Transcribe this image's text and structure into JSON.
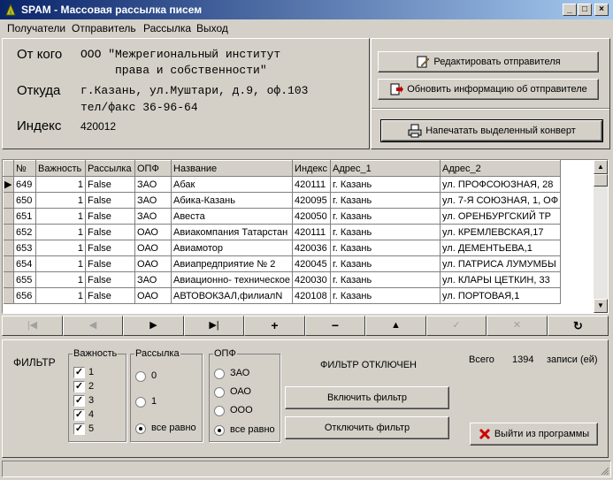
{
  "window": {
    "title": "SPAM - Массовая рассылка писем"
  },
  "menu": [
    "Получатели",
    "Отправитель",
    "Рассылка",
    "Выход"
  ],
  "sender": {
    "from_label": "От кого",
    "from_line1": "ООО \"Межрегиональный институт",
    "from_line2": "права и собственности\"",
    "where_label": "Откуда",
    "address_line1": "г.Казань, ул.Муштари, д.9, оф.103",
    "address_line2": "тел/факс 36-96-64",
    "index_label": "Индекс",
    "index_value": "420012"
  },
  "buttons": {
    "edit_sender": "Редактировать отправителя",
    "update_sender": "Обновить информацию об отправителе",
    "print_envelope": "Напечатать выделенный конверт",
    "enable_filter": "Включить фильтр",
    "disable_filter": "Отключить фильтр",
    "exit": "Выйти из программы"
  },
  "table": {
    "columns": [
      "№",
      "Важность",
      "Рассылка",
      "ОПФ",
      "Название",
      "Индекс",
      "Адрес_1",
      "Адрес_2"
    ],
    "rows": [
      [
        "649",
        "1",
        "False",
        "ЗАО",
        "Абак",
        "420111",
        "г. Казань",
        "ул. ПРОФСОЮЗНАЯ, 28"
      ],
      [
        "650",
        "1",
        "False",
        "ЗАО",
        "Абика-Казань",
        "420095",
        "г. Казань",
        "ул. 7-Я СОЮЗНАЯ, 1, ОФ"
      ],
      [
        "651",
        "1",
        "False",
        "ЗАО",
        "Авеста",
        "420050",
        "г. Казань",
        "ул. ОРЕНБУРГСКИЙ ТР"
      ],
      [
        "652",
        "1",
        "False",
        "ОАО",
        "Авиакомпания Татарстан",
        "420111",
        "г. Казань",
        "ул. КРЕМЛЕВСКАЯ,17"
      ],
      [
        "653",
        "1",
        "False",
        "ОАО",
        "Авиамотор",
        "420036",
        "г. Казань",
        "ул. ДЕМЕНТЬЕВА,1"
      ],
      [
        "654",
        "1",
        "False",
        "ОАО",
        "Авиапредприятие № 2",
        "420045",
        "г. Казань",
        "ул. ПАТРИСА ЛУМУМБЫ"
      ],
      [
        "655",
        "1",
        "False",
        "ЗАО",
        "Авиационно- техническое",
        "420030",
        "г. Казань",
        "ул. КЛАРЫ ЦЕТКИН, 33"
      ],
      [
        "656",
        "1",
        "False",
        "ОАО",
        "АВТОВОКЗАЛ,филиалN",
        "420108",
        "г. Казань",
        "ул. ПОРТОВАЯ,1"
      ]
    ]
  },
  "navigator": [
    "|◀",
    "◀",
    "▶",
    "▶|",
    "+",
    "−",
    "▲",
    "✓",
    "✕",
    "↻"
  ],
  "filter": {
    "label": "ФИЛЬТР",
    "importance_title": "Важность",
    "importance_items": [
      "1",
      "2",
      "3",
      "4",
      "5"
    ],
    "mailing_title": "Рассылка",
    "mailing_options": [
      "0",
      "1",
      "все равно"
    ],
    "opf_title": "ОПФ",
    "opf_options": [
      "ЗАО",
      "ОАО",
      "ООО",
      "все равно"
    ],
    "status": "ФИЛЬТР ОТКЛЮЧЕН",
    "total_label": "Всего",
    "total_value": "1394",
    "total_suffix": "записи (ей)"
  },
  "colors": {
    "titlebar_start": "#0a246a",
    "titlebar_end": "#a6caf0",
    "face": "#d4d0c8",
    "exit_icon": "#cc0000"
  }
}
